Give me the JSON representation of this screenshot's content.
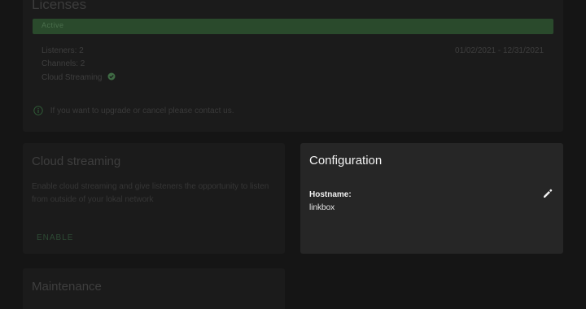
{
  "licenses": {
    "title": "Licenses",
    "status": "Active",
    "listeners": "Listeners: 2",
    "channels": "Channels: 2",
    "cloud_streaming": "Cloud Streaming",
    "dates": "01/02/2021 - 12/31/2021",
    "info_text": "If you want to upgrade or cancel please contact us."
  },
  "cloud_streaming": {
    "title": "Cloud streaming",
    "description": "Enable cloud streaming and give listeners the opportunity to listen from outside of your lokal network",
    "enable_label": "ENABLE"
  },
  "configuration": {
    "title": "Configuration",
    "hostname_label": "Hostname:",
    "hostname_value": "linkbox"
  },
  "maintenance": {
    "title": "Maintenance"
  },
  "icons": {
    "check": "check-circle-icon",
    "info": "info-icon",
    "edit": "pencil-icon"
  },
  "colors": {
    "accent_green": "#2a4a2c",
    "card_bg": "#262626",
    "page_bg": "#151515"
  }
}
